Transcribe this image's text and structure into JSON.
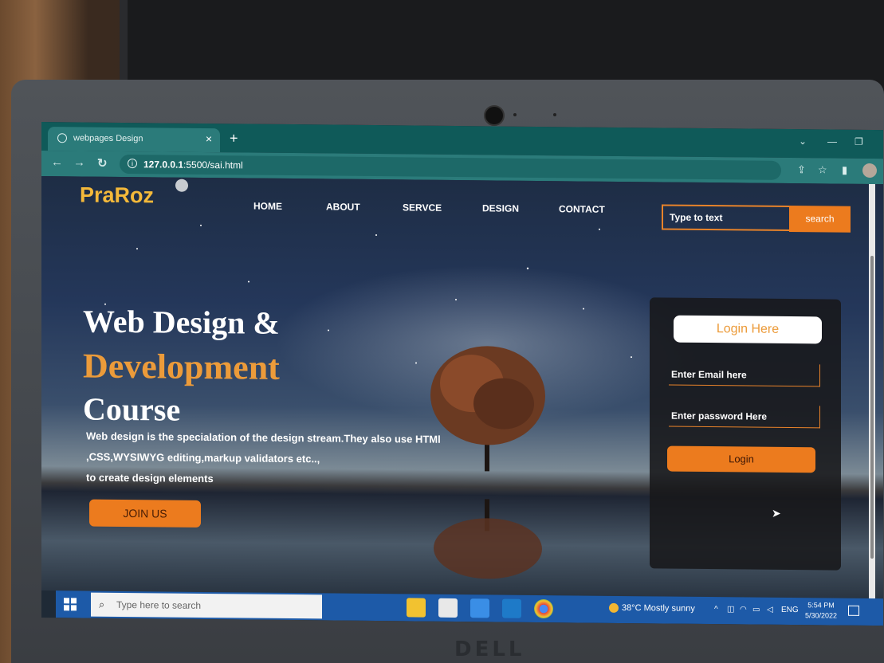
{
  "browser": {
    "tab_title": "webpages Design",
    "tab_close": "×",
    "new_tab": "+",
    "url_host": "127.0.0.1",
    "url_path": ":5500/sai.html"
  },
  "site": {
    "logo": "PraRoz",
    "nav": [
      "HOME",
      "ABOUT",
      "SERVCE",
      "DESIGN",
      "CONTACT"
    ],
    "search_placeholder": "Type to text",
    "search_button": "search"
  },
  "hero": {
    "line1": "Web Design &",
    "line2": "Development",
    "line3": "Course",
    "desc1": "Web design is the specialation of the design stream.They also use HTMl",
    "desc2": ",CSS,WYSIWYG editing,markup validators etc..,",
    "desc3": "to create design elements",
    "join": "JOIN US"
  },
  "login": {
    "title": "Login Here",
    "email_placeholder": "Enter Email here",
    "password_placeholder": "Enter password Here",
    "button": "Login"
  },
  "taskbar": {
    "search_placeholder": "Type here to search",
    "temperature": "38°C",
    "weather": "Mostly sunny",
    "language": "ENG",
    "time": "5:54 PM",
    "date": "5/30/2022"
  },
  "device": {
    "brand": "DELL"
  },
  "colors": {
    "accent": "#ec7b1e",
    "logo": "#f4b93a",
    "chrome": "#2b7b7a"
  }
}
